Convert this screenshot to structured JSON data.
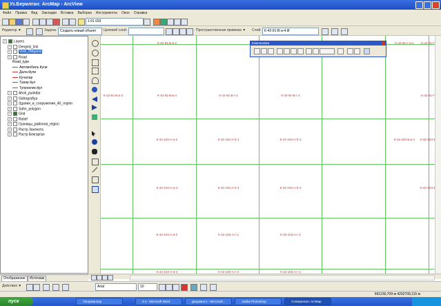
{
  "window": {
    "title": "Уз.Берилган: ArcMap - ArcView"
  },
  "menubar": {
    "items": [
      "Файл",
      "Правка",
      "Вид",
      "Закладки",
      "Вставка",
      "Выборка",
      "Инструменты",
      "Окно",
      "Справка"
    ]
  },
  "toolbar1": {
    "scale_value": "1:91 693"
  },
  "toolbar2": {
    "editor_label": "Редактор ▼",
    "task_label": "Задача:",
    "task_value": "Создать новый объект",
    "target_label": "Целевой слой:",
    "spatial_adjust": "Пространственная привязка ▼",
    "layer_label": "Слой:",
    "layer_value": "К-42-91-В-а-4.tif"
  },
  "toc": {
    "items": [
      {
        "label": "Layers",
        "indent": 0,
        "type": "group",
        "checked": true
      },
      {
        "label": "Dengeiz_linii",
        "indent": 1,
        "type": "layer",
        "checked": false
      },
      {
        "label": "Vodi_Oblganiz",
        "indent": 1,
        "type": "layer",
        "checked": false,
        "selected": true
      },
      {
        "label": "Road",
        "indent": 1,
        "type": "layer",
        "checked": false
      },
      {
        "label": "Road_type",
        "indent": 2,
        "type": "heading",
        "checked": false
      },
      {
        "label": "Автомобиль йули",
        "indent": 2,
        "type": "legend",
        "checked": false
      },
      {
        "label": "Дала йули",
        "indent": 2,
        "type": "legend",
        "checked": false
      },
      {
        "label": "Кучалар",
        "indent": 2,
        "type": "legend",
        "checked": false
      },
      {
        "label": "Тахир йул",
        "indent": 2,
        "type": "legend",
        "checked": false
      },
      {
        "label": "Тупроклик йул",
        "indent": 2,
        "type": "legend",
        "checked": false
      },
      {
        "label": "Aholi_punktlar",
        "indent": 1,
        "type": "layer",
        "checked": false
      },
      {
        "label": "Gidrografiya",
        "indent": 1,
        "type": "layer",
        "checked": false
      },
      {
        "label": "Здания_и_сооружения_40_region",
        "indent": 1,
        "type": "layer",
        "checked": false
      },
      {
        "label": "Sahn_polygon",
        "indent": 1,
        "type": "layer",
        "checked": false
      },
      {
        "label": "Grid",
        "indent": 1,
        "type": "layer",
        "checked": true
      },
      {
        "label": "Relief",
        "indent": 1,
        "type": "layer",
        "checked": false
      },
      {
        "label": "Границы_районов_region",
        "indent": 1,
        "type": "layer",
        "checked": false
      },
      {
        "label": "Растр Зангиота",
        "indent": 1,
        "type": "layer",
        "checked": false
      },
      {
        "label": "Растр Бекгарган",
        "indent": 1,
        "type": "layer",
        "checked": false
      }
    ]
  },
  "tabs": {
    "display": "Отображение",
    "source": "Источник"
  },
  "float_window": {
    "title": "Компоновка"
  },
  "map": {
    "tiles": [
      {
        "label": "К-42-91-В-в-2",
        "col": 1,
        "row": 0
      },
      {
        "label": "К-42-91-Г-а-1",
        "col": 5,
        "row": 0
      },
      {
        "label": "К-42-91-Г-в-2",
        "col": 6,
        "row": 0
      },
      {
        "label": "К-42-91-В-в-3",
        "col": 0,
        "row": 1
      },
      {
        "label": "К-42-91-В-в-4",
        "col": 1,
        "row": 1
      },
      {
        "label": "К-42-91-В-г-3",
        "col": 2,
        "row": 1
      },
      {
        "label": "К-42-91-В-г-4",
        "col": 3,
        "row": 1
      },
      {
        "label": "К-42-91-Г-в-4",
        "col": 6,
        "row": 1
      },
      {
        "label": "К-42-103-А-а-2",
        "col": 1,
        "row": 2
      },
      {
        "label": "К-42-103-А-б-1",
        "col": 2,
        "row": 2
      },
      {
        "label": "К-42-103-А-б-2",
        "col": 3,
        "row": 2
      },
      {
        "label": "К-42-103-Б-а-1",
        "col": 5,
        "row": 2
      },
      {
        "label": "К-42-103-Б-а-2",
        "col": 6,
        "row": 2
      },
      {
        "label": "К-42-103-А-а-4",
        "col": 1,
        "row": 3
      },
      {
        "label": "К-42-103-А-б-3",
        "col": 2,
        "row": 3
      },
      {
        "label": "К-42-103-А-б-4",
        "col": 3,
        "row": 3
      },
      {
        "label": "К-42-103-Б-а-4",
        "col": 6,
        "row": 3
      },
      {
        "label": "К-42-103-А-в-2",
        "col": 1,
        "row": 4
      },
      {
        "label": "К-42-103-А-г-1",
        "col": 2,
        "row": 4
      },
      {
        "label": "К-42-103-А-г-2",
        "col": 3,
        "row": 4
      },
      {
        "label": "К-42-103-А-в-4",
        "col": 1,
        "row": 5
      },
      {
        "label": "К-42-103-А-г-3",
        "col": 2,
        "row": 5
      },
      {
        "label": "К-42-103-А-г-4",
        "col": 3,
        "row": 5
      }
    ]
  },
  "drawbar": {
    "draw_label": "Действия ▼",
    "font_value": "Arial",
    "size_value": "10"
  },
  "statusbar": {
    "coords": "691230,709 м  4292709,115 м"
  },
  "taskbar": {
    "start": "пуск",
    "tasks": [
      {
        "label": "Тагерманлар"
      },
      {
        "label": "3.3 - Microsoft Word"
      },
      {
        "label": "Документ1 - Microsoft..."
      },
      {
        "label": "Adobe Photoshop"
      },
      {
        "label": "Уз.Берилган: ArcMap"
      }
    ],
    "clock": ""
  },
  "colors": {
    "grid": "#5ec55e",
    "tile_label": "#d23030",
    "title_bar": "#1d4fc4"
  }
}
